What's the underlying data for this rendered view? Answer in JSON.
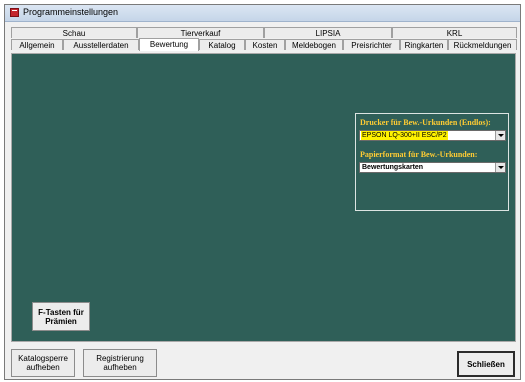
{
  "window": {
    "title": "Programmeinstellungen"
  },
  "tabs_row1": [
    {
      "label": "Schau"
    },
    {
      "label": "Tierverkauf"
    },
    {
      "label": "LIPSIA"
    },
    {
      "label": "KRL"
    }
  ],
  "tabs_row2": [
    {
      "label": "Allgemein"
    },
    {
      "label": "Ausstellerdaten"
    },
    {
      "label": "Bewertung",
      "active": true
    },
    {
      "label": "Katalog"
    },
    {
      "label": "Kosten"
    },
    {
      "label": "Meldebogen"
    },
    {
      "label": "Preisrichter"
    },
    {
      "label": "Ringkarten"
    },
    {
      "label": "Rückmeldungen"
    }
  ],
  "printer_section": {
    "printer_label": "Drucker für Bew.-Urkunden (Endlos):",
    "printer_value": "EPSON LQ-300+II ESC/P2",
    "paper_label": "Papierformat für Bew.-Urkunden:",
    "paper_value": "Bewertungskarten"
  },
  "buttons": {
    "fkeys_line1": "F-Tasten für",
    "fkeys_line2": "Prämien",
    "catalog_lock_line1": "Katalogsperre",
    "catalog_lock_line2": "aufheben",
    "registration_line1": "Registrierung",
    "registration_line2": "aufheben",
    "close": "Schließen"
  },
  "colors": {
    "panel_bg": "#2f5f58",
    "label_text": "#ffcc33",
    "selection_highlight": "#fff200"
  }
}
